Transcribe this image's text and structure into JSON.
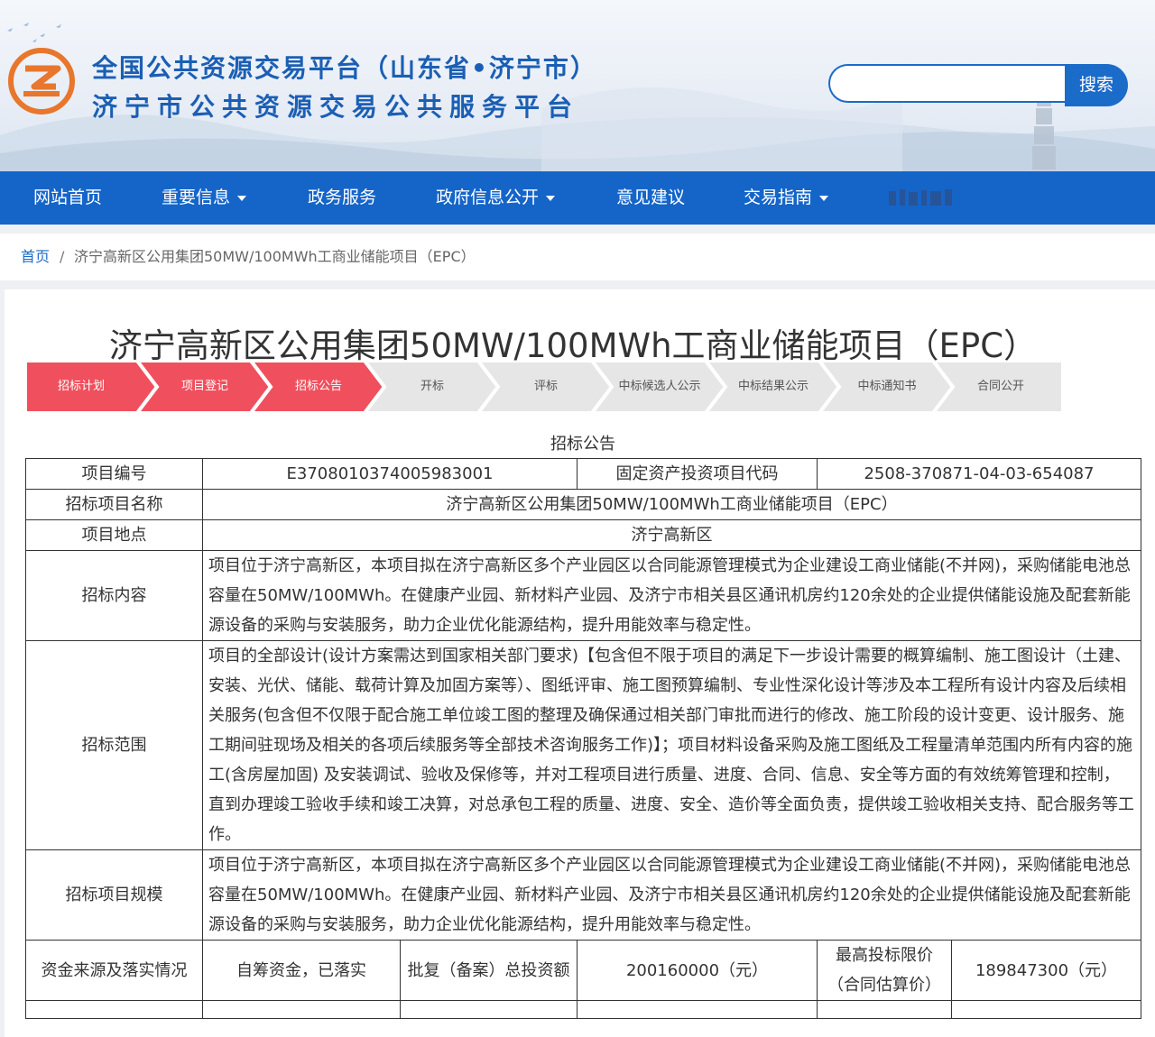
{
  "header": {
    "title_line1": "全国公共资源交易平台（山东省•济宁市）",
    "title_line2": "济宁市公共资源交易公共服务平台",
    "search_placeholder": "",
    "search_button": "搜索"
  },
  "nav": {
    "items": [
      {
        "label": "网站首页",
        "dropdown": false
      },
      {
        "label": "重要信息",
        "dropdown": true
      },
      {
        "label": "政务服务",
        "dropdown": false
      },
      {
        "label": "政府信息公开",
        "dropdown": true
      },
      {
        "label": "意见建议",
        "dropdown": false
      },
      {
        "label": "交易指南",
        "dropdown": true
      }
    ]
  },
  "breadcrumb": {
    "home": "首页",
    "separator": "/",
    "current": "济宁高新区公用集团50MW/100MWh工商业储能项目（EPC）"
  },
  "page_title": "济宁高新区公用集团50MW/100MWh工商业储能项目（EPC）",
  "steps": [
    {
      "label": "招标计划",
      "active": true
    },
    {
      "label": "项目登记",
      "active": true
    },
    {
      "label": "招标公告",
      "active": true
    },
    {
      "label": "开标",
      "active": false
    },
    {
      "label": "评标",
      "active": false
    },
    {
      "label": "中标候选人公示",
      "active": false
    },
    {
      "label": "中标结果公示",
      "active": false
    },
    {
      "label": "中标通知书",
      "active": false
    },
    {
      "label": "合同公开",
      "active": false
    }
  ],
  "colors": {
    "active_step": "#f0505e",
    "inactive_step": "#e6e6e6",
    "nav_bg": "#1565c9",
    "brand_blue": "#1b5fb4",
    "logo_orange": "#e8762c"
  },
  "notice": {
    "section_title": "招标公告",
    "project_no_label": "项目编号",
    "project_no": "E3708010374005983001",
    "fixed_asset_label": "固定资产投资项目代码",
    "fixed_asset_code": "2508-370871-04-03-654087",
    "name_label": "招标项目名称",
    "name": "济宁高新区公用集团50MW/100MWh工商业储能项目（EPC）",
    "location_label": "项目地点",
    "location": "济宁高新区",
    "content_label": "招标内容",
    "content": "项目位于济宁高新区，本项目拟在济宁高新区多个产业园区以合同能源管理模式为企业建设工商业储能(不并网)，采购储能电池总容量在50MW/100MWh。在健康产业园、新材料产业园、及济宁市相关县区通讯机房约120余处的企业提供储能设施及配套新能源设备的采购与安装服务，助力企业优化能源结构，提升用能效率与稳定性。",
    "scope_label": "招标范围",
    "scope": "项目的全部设计(设计方案需达到国家相关部门要求)【包含但不限于项目的满足下一步设计需要的概算编制、施工图设计（土建、安装、光伏、储能、载荷计算及加固方案等）、图纸评审、施工图预算编制、专业性深化设计等涉及本工程所有设计内容及后续相关服务(包含但不仅限于配合施工单位竣工图的整理及确保通过相关部门审批而进行的修改、施工阶段的设计变更、设计服务、施工期间驻现场及相关的各项后续服务等全部技术咨询服务工作)】；项目材料设备采购及施工图纸及工程量清单范围内所有内容的施工(含房屋加固) 及安装调试、验收及保修等，并对工程项目进行质量、进度、合同、信息、安全等方面的有效统筹管理和控制，直到办理竣工验收手续和竣工决算，对总承包工程的质量、进度、安全、造价等全面负责，提供竣工验收相关支持、配合服务等工作。",
    "scale_label": "招标项目规模",
    "scale": "项目位于济宁高新区，本项目拟在济宁高新区多个产业园区以合同能源管理模式为企业建设工商业储能(不并网)，采购储能电池总容量在50MW/100MWh。在健康产业园、新材料产业园、及济宁市相关县区通讯机房约120余处的企业提供储能设施及配套新能源设备的采购与安装服务，助力企业优化能源结构，提升用能效率与稳定性。",
    "fund_label": "资金来源及落实情况",
    "fund": "自筹资金，已落实",
    "invest_label": "批复（备案）总投资额",
    "invest": "200160000（元）",
    "max_price_label": "最高投标限价（合同估算价）",
    "max_price": "189847300（元）"
  }
}
